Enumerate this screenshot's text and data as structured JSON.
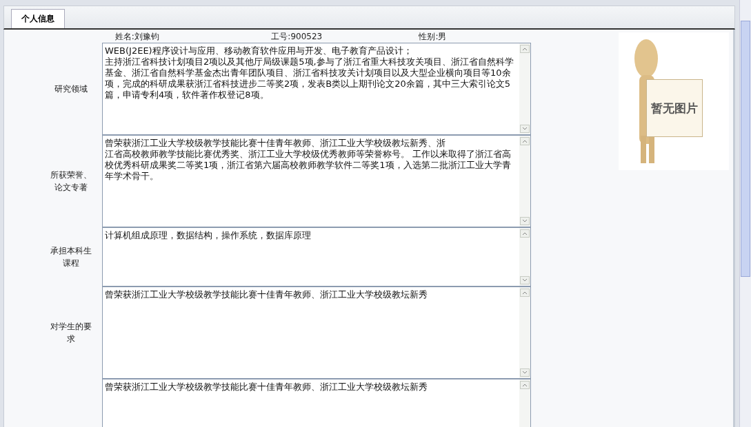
{
  "tabs": [
    {
      "label": "个人信息",
      "selected": true
    }
  ],
  "header": {
    "name": "姓名:刘豫钧",
    "staff_no": "工号:900523",
    "gender": "性别:男"
  },
  "photo": {
    "sign_text": "暂无图片"
  },
  "fields": [
    {
      "label": "研究领域",
      "paragraphs": [
        "WEB(J2EE)程序设计与应用、移动教育软件应用与开发、电子教育产品设计；",
        "主持浙江省科技计划项目2项以及其他厅局级课题5项,参与了浙江省重大科技攻关项目、浙江省自然科学基金、浙江省自然科学基金杰出青年团队项目、浙江省科技攻关计划项目以及大型企业横向项目等10余项，完成的科研成果获浙江省科技进步二等奖2项，发表B类以上期刊论文20余篇，其中三大索引论文5篇，申请专利4项，软件著作权登记8项。"
      ]
    },
    {
      "label": "所获荣誉、论文专著",
      "paragraphs": [
        "曾荣获浙江工业大学校级教学技能比赛十佳青年教师、浙江工业大学校级教坛新秀、浙",
        "江省高校教师教学技能比赛优秀奖、浙江工业大学校级优秀教师等荣誉称号。 工作以来取得了浙江省高校优秀科研成果奖二等奖1项，浙江省第六届高校教师教学软件二等奖1项，入选第二批浙江工业大学青年学术骨干。"
      ]
    },
    {
      "label": "承担本科生课程",
      "paragraphs": [
        "计算机组成原理，数据结构，操作系统，数据库原理"
      ]
    },
    {
      "label": "对学生的要求",
      "paragraphs": [
        "曾荣获浙江工业大学校级教学技能比赛十佳青年教师、浙江工业大学校级教坛新秀"
      ]
    },
    {
      "paragraphs": [
        "曾荣获浙江工业大学校级教学技能比赛十佳青年教师、浙江工业大学校级教坛新秀"
      ]
    }
  ]
}
